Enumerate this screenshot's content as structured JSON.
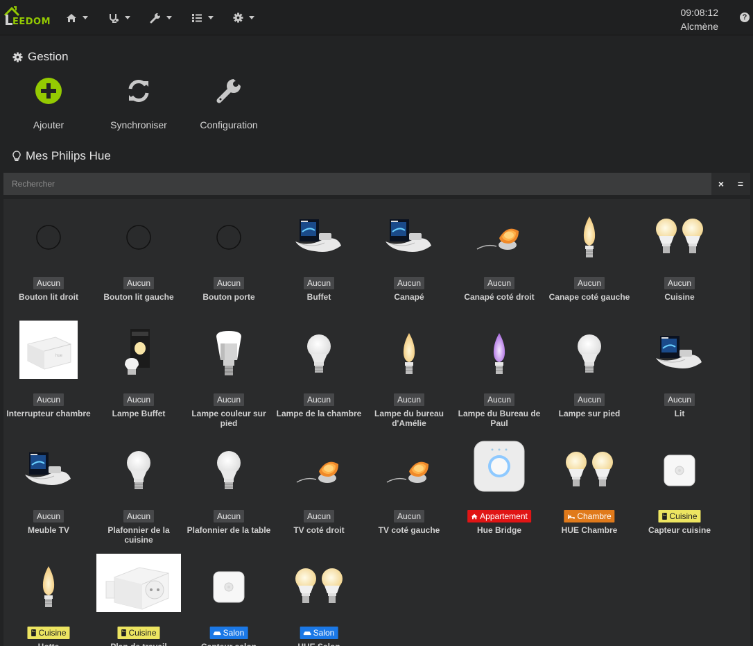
{
  "navbar": {
    "brand": "EEDOM",
    "time": "09:08:12",
    "user": "Alcmène",
    "help_label": "?",
    "menus": [
      {
        "icon": "home-icon"
      },
      {
        "icon": "stethoscope-icon"
      },
      {
        "icon": "wrench-icon"
      },
      {
        "icon": "tasks-icon"
      },
      {
        "icon": "gear-icon"
      }
    ]
  },
  "gestion": {
    "title": "Gestion",
    "add_label": "Ajouter",
    "sync_label": "Synchroniser",
    "config_label": "Configuration"
  },
  "devices_section": {
    "title": "Mes Philips Hue",
    "search_placeholder": "Rechercher",
    "clear_label": "×",
    "toggle_label": "="
  },
  "colors": {
    "accent_green": "#94ca02",
    "badge_red": "#e01515",
    "badge_orange": "#e07a1b",
    "badge_yellow": "#ede561",
    "badge_blue": "#1b78e6"
  },
  "devices": [
    {
      "name": "Bouton lit droit",
      "room": "Aucun",
      "room_icon": "",
      "image": "circle-icon",
      "badge": "none"
    },
    {
      "name": "Bouton lit gauche",
      "room": "Aucun",
      "room_icon": "",
      "image": "circle-icon",
      "badge": "none"
    },
    {
      "name": "Bouton porte",
      "room": "Aucun",
      "room_icon": "",
      "image": "circle-icon",
      "badge": "none"
    },
    {
      "name": "Buffet",
      "room": "Aucun",
      "room_icon": "",
      "image": "lightstrip-box-icon",
      "badge": "none"
    },
    {
      "name": "Canapé",
      "room": "Aucun",
      "room_icon": "",
      "image": "lightstrip-box-icon",
      "badge": "none"
    },
    {
      "name": "Canapé coté droit",
      "room": "Aucun",
      "room_icon": "",
      "image": "bloom-lamp-icon",
      "badge": "none"
    },
    {
      "name": "Canape coté gauche",
      "room": "Aucun",
      "room_icon": "",
      "image": "candle-bulb-icon",
      "badge": "none"
    },
    {
      "name": "Cuisine",
      "room": "Aucun",
      "room_icon": "",
      "image": "double-bulb-icon",
      "badge": "none"
    },
    {
      "name": "Interrupteur chambre",
      "room": "Aucun",
      "room_icon": "",
      "image": "wall-switch-module-icon",
      "badge": "none"
    },
    {
      "name": "Lampe Buffet",
      "room": "Aucun",
      "room_icon": "",
      "image": "bulb-box-icon",
      "badge": "none"
    },
    {
      "name": "Lampe couleur sur pied",
      "room": "Aucun",
      "room_icon": "",
      "image": "br30-bulb-icon",
      "badge": "none"
    },
    {
      "name": "Lampe de la chambre",
      "room": "Aucun",
      "room_icon": "",
      "image": "white-bulb-icon",
      "badge": "none"
    },
    {
      "name": "Lampe du bureau d'Amélie",
      "room": "Aucun",
      "room_icon": "",
      "image": "candle-bulb-icon",
      "badge": "none"
    },
    {
      "name": "Lampe du Bureau de Paul",
      "room": "Aucun",
      "room_icon": "",
      "image": "purple-candle-bulb-icon",
      "badge": "none"
    },
    {
      "name": "Lampe sur pied",
      "room": "Aucun",
      "room_icon": "",
      "image": "white-bulb-icon",
      "badge": "none"
    },
    {
      "name": "Lit",
      "room": "Aucun",
      "room_icon": "",
      "image": "lightstrip-box-icon",
      "badge": "none"
    },
    {
      "name": "Meuble TV",
      "room": "Aucun",
      "room_icon": "",
      "image": "lightstrip-box-icon",
      "badge": "none"
    },
    {
      "name": "Plafonnier de la cuisine",
      "room": "Aucun",
      "room_icon": "",
      "image": "white-bulb-icon",
      "badge": "none"
    },
    {
      "name": "Plafonnier de la table",
      "room": "Aucun",
      "room_icon": "",
      "image": "white-bulb-icon",
      "badge": "none"
    },
    {
      "name": "TV coté droit",
      "room": "Aucun",
      "room_icon": "",
      "image": "bloom-lamp-icon",
      "badge": "none"
    },
    {
      "name": "TV coté gauche",
      "room": "Aucun",
      "room_icon": "",
      "image": "bloom-lamp-icon",
      "badge": "none"
    },
    {
      "name": "Hue Bridge",
      "room": "Appartement",
      "room_icon": "home-icon",
      "image": "hue-bridge-icon",
      "badge": "red"
    },
    {
      "name": "HUE Chambre",
      "room": "Chambre",
      "room_icon": "bed-icon",
      "image": "double-bulb-icon",
      "badge": "orange"
    },
    {
      "name": "Capteur cuisine",
      "room": "Cuisine",
      "room_icon": "fridge-icon",
      "image": "motion-sensor-icon",
      "badge": "yellow"
    },
    {
      "name": "Hotte",
      "room": "Cuisine",
      "room_icon": "fridge-icon",
      "image": "candle-bulb-icon",
      "badge": "yellow"
    },
    {
      "name": "Plan de travail",
      "room": "Cuisine",
      "room_icon": "fridge-icon",
      "image": "smart-plug-icon",
      "badge": "yellow"
    },
    {
      "name": "Capteur salon",
      "room": "Salon",
      "room_icon": "sofa-icon",
      "image": "motion-sensor-icon",
      "badge": "blue"
    },
    {
      "name": "HUE Salon",
      "room": "Salon",
      "room_icon": "sofa-icon",
      "image": "double-bulb-icon",
      "badge": "blue"
    }
  ]
}
